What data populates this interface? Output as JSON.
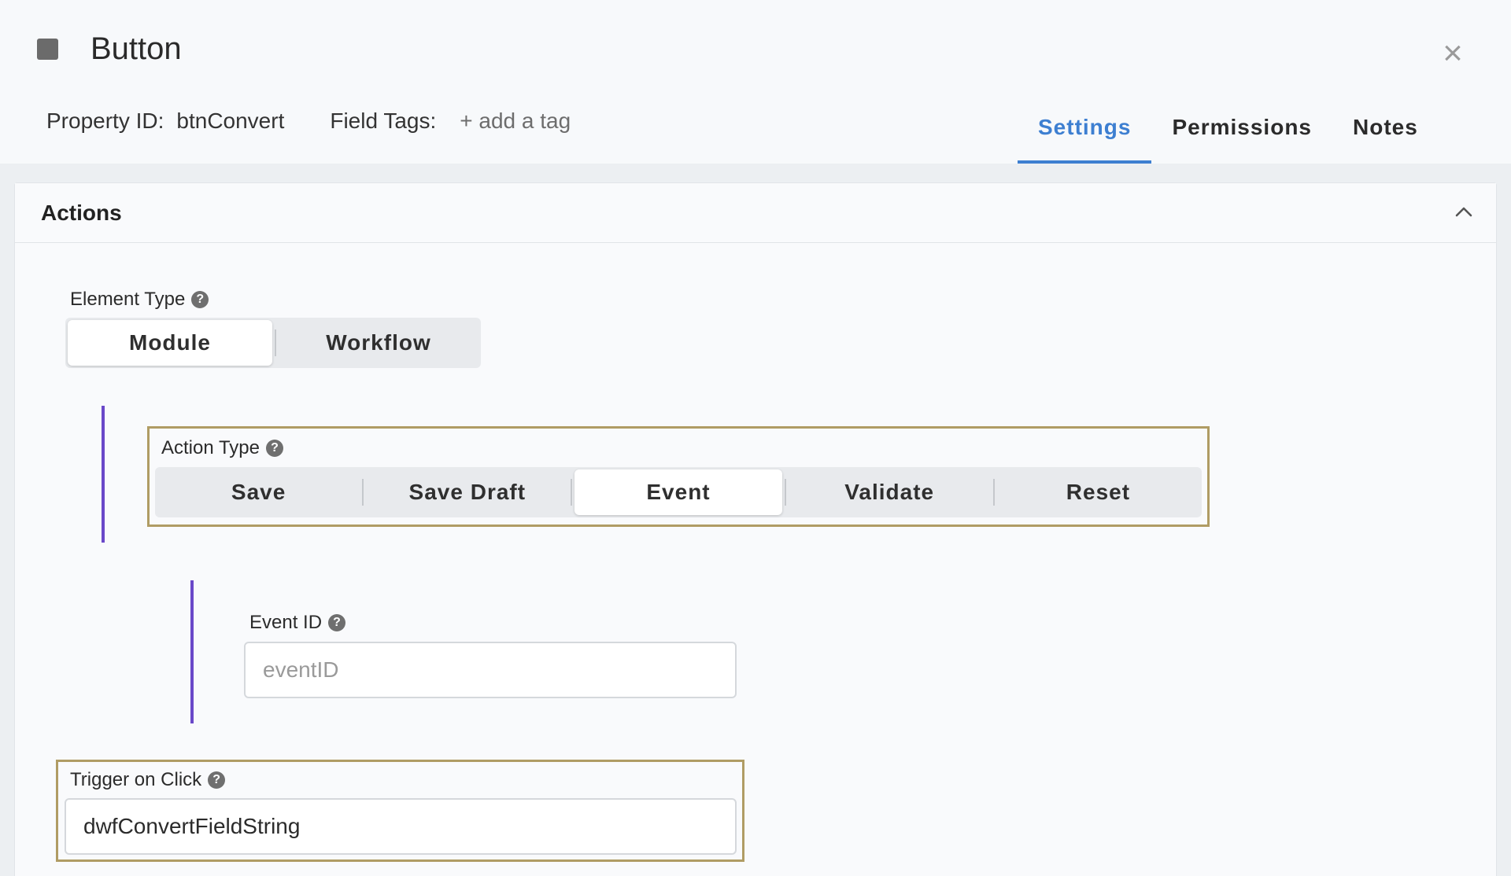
{
  "header": {
    "title": "Button",
    "property_id_label": "Property ID:",
    "property_id_value": "btnConvert",
    "field_tags_label": "Field Tags:",
    "add_tag_label": "+ add a tag",
    "close_icon": "×"
  },
  "tabs": [
    {
      "label": "Settings",
      "active": true
    },
    {
      "label": "Permissions",
      "active": false
    },
    {
      "label": "Notes",
      "active": false
    }
  ],
  "panel": {
    "title": "Actions",
    "element_type": {
      "label": "Element Type",
      "options": [
        "Module",
        "Workflow"
      ],
      "selected": "Module"
    },
    "action_type": {
      "label": "Action Type",
      "options": [
        "Save",
        "Save Draft",
        "Event",
        "Validate",
        "Reset"
      ],
      "selected": "Event"
    },
    "event_id": {
      "label": "Event ID",
      "placeholder": "eventID",
      "value": ""
    },
    "trigger_on_click": {
      "label": "Trigger on Click",
      "value": "dwfConvertFieldString"
    }
  },
  "colors": {
    "accent": "#3d7fd1",
    "highlight_border": "#b09c64",
    "nested_bar": "#6a48c9"
  },
  "icons": {
    "help": "?",
    "collapse": "chevron-up-icon",
    "app": "square-icon",
    "close": "close-icon"
  }
}
